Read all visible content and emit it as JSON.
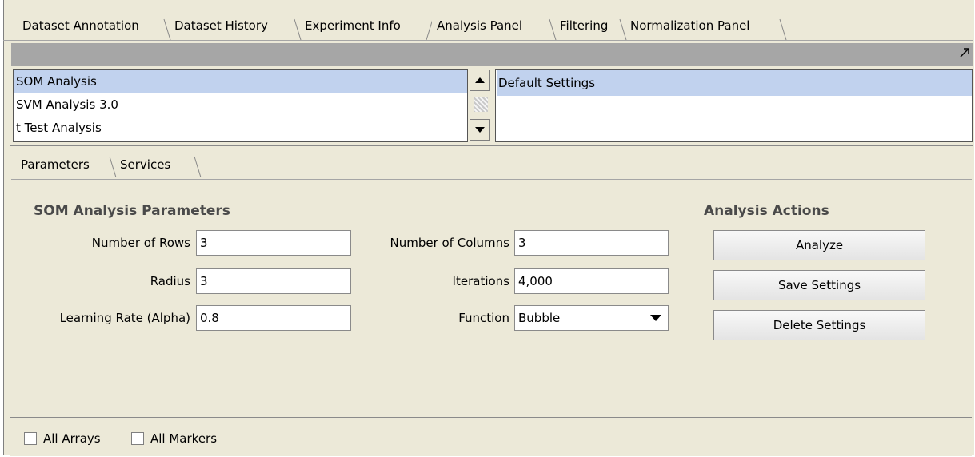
{
  "main_tabs": [
    {
      "label": "Dataset Annotation"
    },
    {
      "label": "Dataset History"
    },
    {
      "label": "Experiment Info"
    },
    {
      "label": "Analysis Panel"
    },
    {
      "label": "Filtering"
    },
    {
      "label": "Normalization Panel"
    }
  ],
  "active_main_tab": "Analysis Panel",
  "analysis_list": {
    "items": [
      "SOM Analysis",
      "SVM Analysis 3.0",
      "t Test Analysis"
    ],
    "selected": "SOM Analysis"
  },
  "settings_list": {
    "items": [
      "Default Settings"
    ],
    "selected": "Default Settings"
  },
  "sub_tabs": [
    {
      "label": "Parameters"
    },
    {
      "label": "Services"
    }
  ],
  "active_sub_tab": "Parameters",
  "parameters": {
    "title": "SOM Analysis Parameters",
    "rows_label": "Number of Rows",
    "rows_value": "3",
    "columns_label": "Number of Columns",
    "columns_value": "3",
    "radius_label": "Radius",
    "radius_value": "3",
    "iterations_label": "Iterations",
    "iterations_value": "4,000",
    "alpha_label": "Learning Rate (Alpha)",
    "alpha_value": "0.8",
    "function_label": "Function",
    "function_value": "Bubble"
  },
  "actions": {
    "title": "Analysis Actions",
    "analyze": "Analyze",
    "save": "Save Settings",
    "delete": "Delete Settings"
  },
  "bottom": {
    "all_arrays": "All Arrays",
    "all_markers": "All Markers"
  },
  "icons": {
    "expand": "expand-arrow-icon",
    "scroll_up": "up-arrow-icon",
    "scroll_down": "down-arrow-icon",
    "combo": "chevron-down-icon"
  },
  "colors": {
    "background": "#ece9d8",
    "header_bar": "#a6a6a6",
    "selection": "#c1d2ee"
  }
}
